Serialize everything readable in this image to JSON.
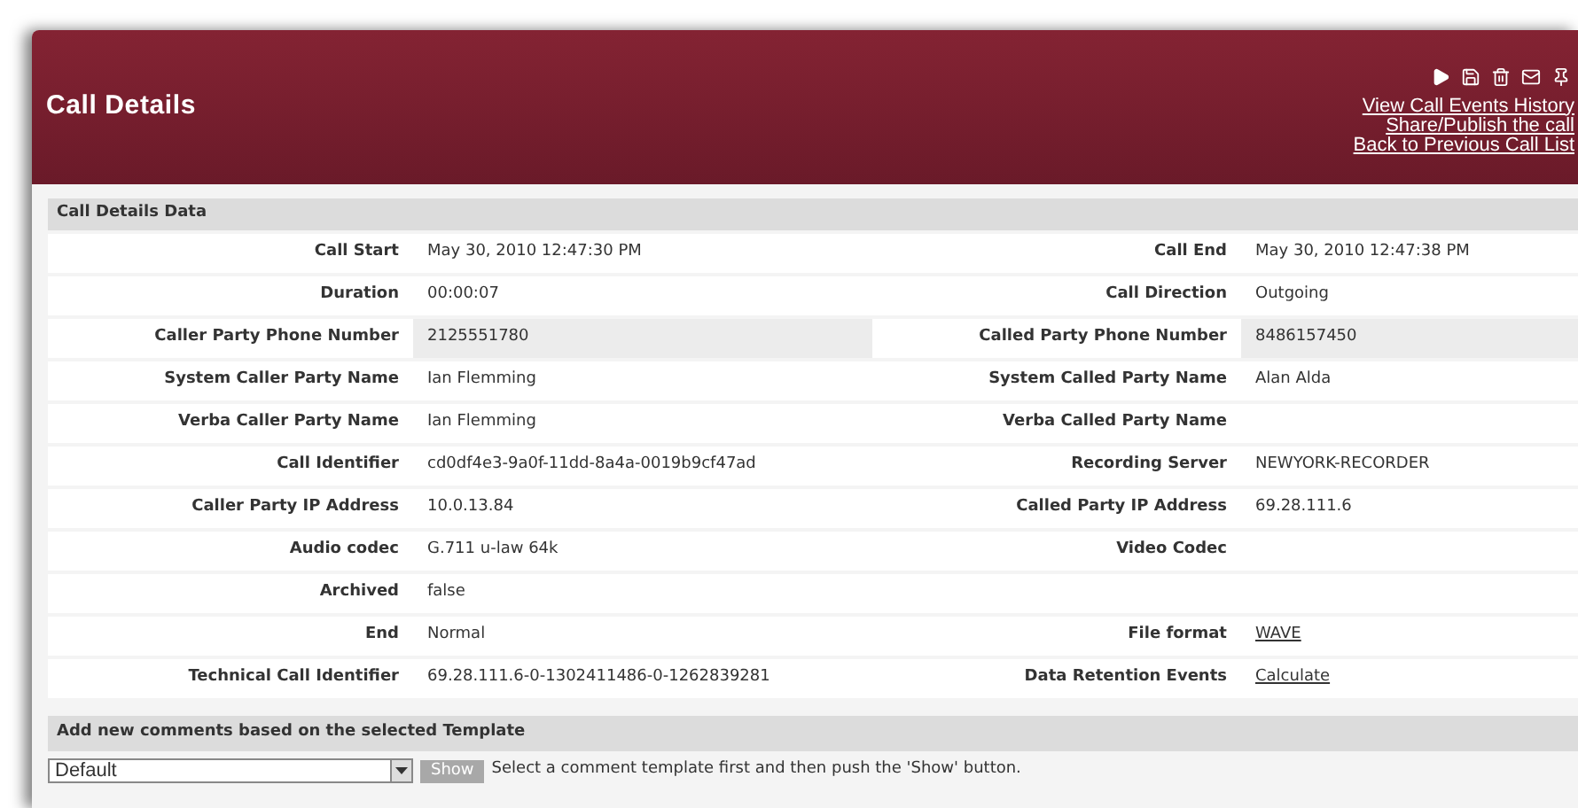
{
  "header": {
    "title": "Call Details",
    "links": [
      "View Call Events History",
      "Share/Publish the call",
      "Back to Previous Call List"
    ]
  },
  "details": {
    "title": "Call Details Data",
    "rows": [
      {
        "highlighted": false,
        "left": {
          "label": "Call Start",
          "value": "May 30, 2010 12:47:30 PM",
          "kind": "text"
        },
        "right": {
          "label": "Call End",
          "value": "May 30, 2010 12:47:38 PM",
          "kind": "text"
        }
      },
      {
        "highlighted": false,
        "left": {
          "label": "Duration",
          "value": "00:00:07",
          "kind": "text"
        },
        "right": {
          "label": "Call Direction",
          "value": "Outgoing",
          "kind": "text"
        }
      },
      {
        "highlighted": true,
        "left": {
          "label": "Caller Party Phone Number",
          "value": "2125551780",
          "kind": "text"
        },
        "right": {
          "label": "Called Party Phone Number",
          "value": "8486157450",
          "kind": "text"
        }
      },
      {
        "highlighted": false,
        "left": {
          "label": "System Caller Party Name",
          "value": "Ian Flemming",
          "kind": "text"
        },
        "right": {
          "label": "System Called Party Name",
          "value": "Alan Alda",
          "kind": "text"
        }
      },
      {
        "highlighted": false,
        "left": {
          "label": "Verba Caller Party Name",
          "value": "Ian Flemming",
          "kind": "text"
        },
        "right": {
          "label": "Verba Called Party Name"
        }
      },
      {
        "highlighted": false,
        "left": {
          "label": "Call Identifier",
          "value": "cd0df4e3-9a0f-11dd-8a4a-0019b9cf47ad",
          "kind": "text"
        },
        "right": {
          "label": "Recording Server",
          "value": "NEWYORK-RECORDER",
          "kind": "text"
        }
      },
      {
        "highlighted": false,
        "left": {
          "label": "Caller Party IP Address",
          "value": "10.0.13.84",
          "kind": "text"
        },
        "right": {
          "label": "Called Party IP Address",
          "value": "69.28.111.6",
          "kind": "text"
        }
      },
      {
        "highlighted": false,
        "left": {
          "label": "Audio codec",
          "value": "G.711 u-law 64k",
          "kind": "text"
        },
        "right": {
          "label": "Video Codec"
        }
      },
      {
        "highlighted": false,
        "left": {
          "label": "Archived",
          "value": "false",
          "kind": "text"
        }
      },
      {
        "highlighted": false,
        "left": {
          "label": "End",
          "value": "Normal",
          "kind": "text"
        },
        "right": {
          "label": "File format",
          "value": "WAVE",
          "kind": "link"
        }
      },
      {
        "highlighted": false,
        "left": {
          "label": "Technical Call Identifier",
          "value": "69.28.111.6-0-1302411486-0-1262839281",
          "kind": "text"
        },
        "right": {
          "label": "Data Retention Events",
          "value": "Calculate",
          "kind": "link"
        }
      }
    ]
  },
  "comments": {
    "title": "Add new comments based on the selected Template",
    "select_value": "Default",
    "button": "Show",
    "hint": "Select a comment template first and then push the 'Show' button."
  }
}
